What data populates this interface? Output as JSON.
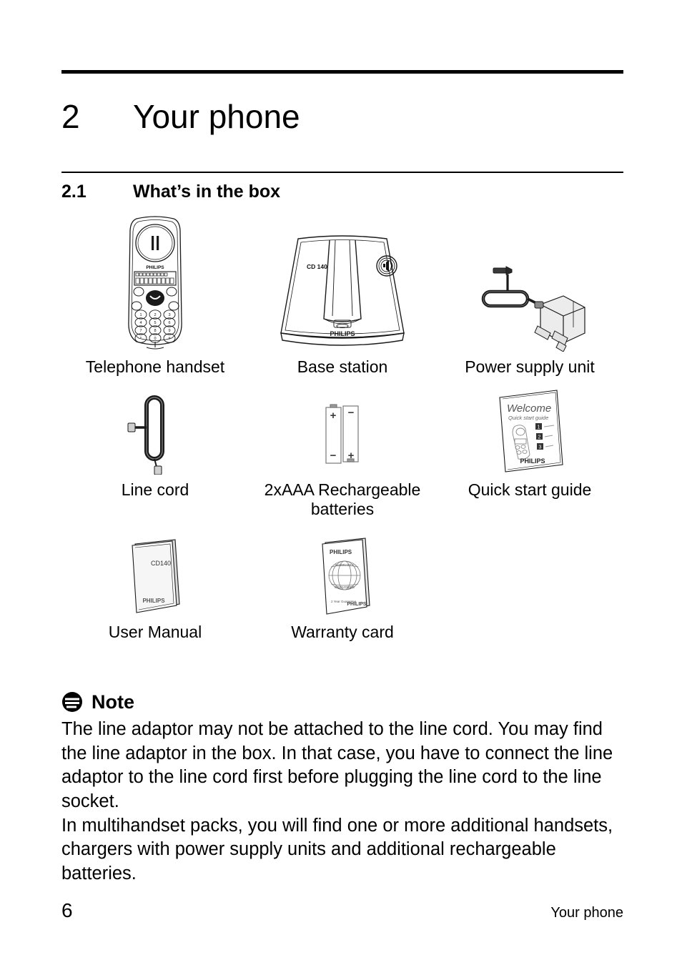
{
  "header": {
    "chapter_number": "2",
    "chapter_title": "Your phone",
    "section_number": "2.1",
    "section_title": "What’s in the box"
  },
  "box_contents": {
    "row1": [
      {
        "caption": "Telephone handset",
        "icon": "telephone-handset-illustration"
      },
      {
        "caption": "Base station",
        "icon": "base-station-illustration"
      },
      {
        "caption": "Power supply unit",
        "icon": "power-supply-unit-illustration"
      }
    ],
    "row2": [
      {
        "caption": "Line cord",
        "icon": "line-cord-illustration"
      },
      {
        "caption": "2xAAA Rechargeable batteries",
        "icon": "aaa-batteries-illustration"
      },
      {
        "caption": "Quick start guide",
        "icon": "quick-start-guide-illustration"
      }
    ],
    "row3": [
      {
        "caption": "User Manual",
        "icon": "user-manual-illustration"
      },
      {
        "caption": "Warranty card",
        "icon": "warranty-card-illustration"
      }
    ]
  },
  "artwork_labels": {
    "handset_brand": "PHILIPS",
    "base_model": "CD 140",
    "base_brand": "PHILIPS",
    "keypad": [
      "1",
      "2",
      "3",
      "4",
      "5",
      "6",
      "7",
      "8",
      "9",
      "*",
      "0",
      "#"
    ],
    "qsg_title": "Welcome",
    "qsg_subtitle": "Quick start guide",
    "qsg_steps": [
      "1",
      "2",
      "3"
    ],
    "qsg_brand": "PHILIPS",
    "manual_model": "CD140",
    "manual_brand": "PHILIPS",
    "warranty_brand_top": "PHILIPS",
    "warranty_brand_bottom": "PHILIPS",
    "battery_plus": "+",
    "battery_minus": "−"
  },
  "note": {
    "icon": "note-icon",
    "title": "Note",
    "paragraphs": [
      "The line adaptor may not be attached to the line cord. You may find the line adaptor in the box. In that case, you have to connect the line adaptor to the line cord first before plugging the line cord to the line socket.",
      "In multihandset packs, you will find one or more additional handsets, chargers with power supply units and additional rechargeable batteries."
    ]
  },
  "footer": {
    "page_number": "6",
    "running_title": "Your phone"
  },
  "colors": {
    "text": "#000000",
    "background": "#ffffff",
    "line_art_stroke": "#1a1a1a",
    "shade_light": "#d8d8d8",
    "shade_mid": "#9a9a9a"
  }
}
